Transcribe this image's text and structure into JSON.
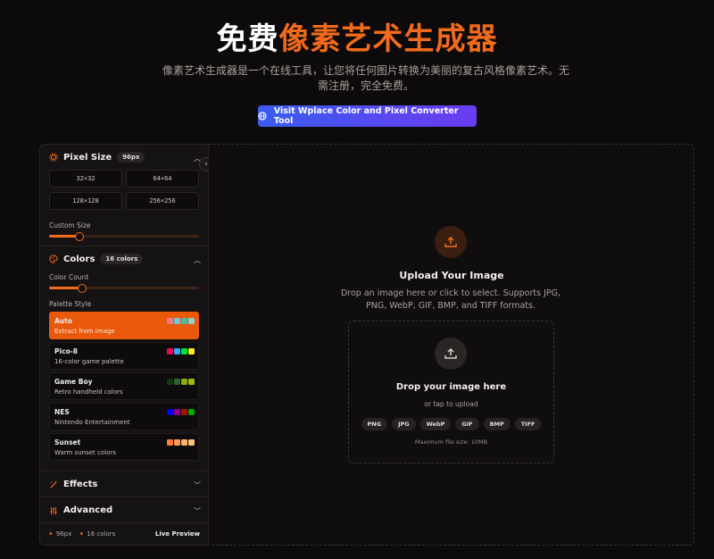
{
  "hero": {
    "title_white": "免费",
    "title_orange": "像素艺术生成器",
    "subtitle": "像素艺术生成器是一个在线工具，让您将任何图片转换为美丽的复古风格像素艺术。无需注册，完全免费。",
    "cta_label": "Visit Wplace Color and Pixel Converter Tool"
  },
  "sidebar": {
    "pixel_size": {
      "title": "Pixel Size",
      "badge": "96px",
      "sizes": [
        "32×32",
        "64×64",
        "128×128",
        "256×256"
      ],
      "custom_label": "Custom Size",
      "custom_level": 0.2
    },
    "colors": {
      "title": "Colors",
      "badge": "16 colors",
      "count_label": "Color Count",
      "count_level": 0.22,
      "palette_label": "Palette Style",
      "palettes": [
        {
          "name": "Auto",
          "desc": "Extract from image",
          "swatches": [
            "#f47a8a",
            "#6dc7d4",
            "#4fb8a4",
            "#8fd0c8"
          ]
        },
        {
          "name": "Pico-8",
          "desc": "16-color game palette",
          "swatches": [
            "#ff004d",
            "#29adff",
            "#00e436",
            "#ffec27"
          ]
        },
        {
          "name": "Game Boy",
          "desc": "Retro handheld colors",
          "swatches": [
            "#0f380f",
            "#306230",
            "#8bac0f",
            "#9bbc0f"
          ]
        },
        {
          "name": "NES",
          "desc": "Nintendo Entertainment",
          "swatches": [
            "#0000fc",
            "#940084",
            "#a81000",
            "#00a800"
          ]
        },
        {
          "name": "Sunset",
          "desc": "Warm sunset colors",
          "swatches": [
            "#ff7b3a",
            "#ff9e5a",
            "#ffb26b",
            "#ffc47a"
          ]
        }
      ]
    },
    "effects": {
      "title": "Effects"
    },
    "advanced": {
      "title": "Advanced"
    },
    "footer": {
      "size": "96px",
      "colors": "16 colors",
      "live": "Live Preview"
    }
  },
  "upload": {
    "title": "Upload Your Image",
    "desc": "Drop an image here or click to select. Supports JPG, PNG, WebP, GIF, BMP, and TIFF formats.",
    "inner_title": "Drop your image here",
    "inner_sub": "or tap to upload",
    "formats": [
      "PNG",
      "JPG",
      "WebP",
      "GIF",
      "BMP",
      "TIFF"
    ],
    "max_size": "Maximum file size: 10MB"
  },
  "colors": {
    "accent": "#f26a1b",
    "cta_start": "#3a5cf0",
    "cta_end": "#6b3cf0"
  },
  "icons": {
    "cta": "globe-icon",
    "pixel_size": "gear-icon",
    "colors": "palette-icon",
    "effects": "wand-icon",
    "advanced": "sliders-icon",
    "upload": "upload-icon",
    "collapse": "chevron-left-icon"
  }
}
